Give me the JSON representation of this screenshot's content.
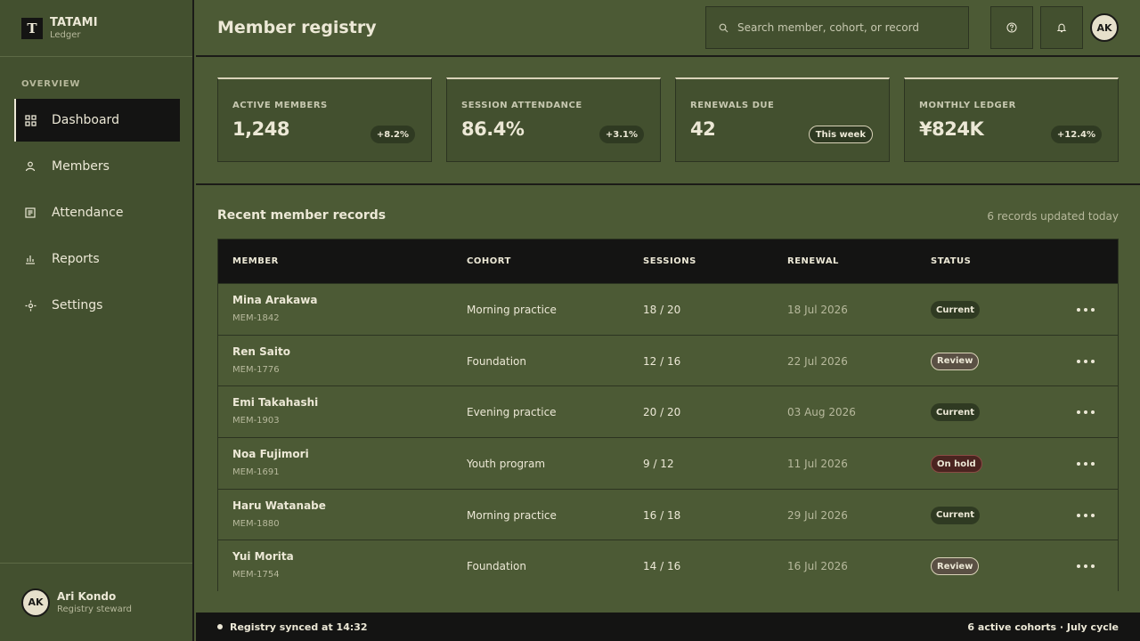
{
  "brand": {
    "mark": "T",
    "name": "TATAMI",
    "sub": "Ledger"
  },
  "nav": {
    "section": "OVERVIEW",
    "items": [
      {
        "label": "Dashboard",
        "icon": "grid-icon",
        "active": true
      },
      {
        "label": "Members",
        "icon": "person-icon"
      },
      {
        "label": "Attendance",
        "icon": "list-icon"
      },
      {
        "label": "Reports",
        "icon": "bar-chart-icon"
      },
      {
        "label": "Settings",
        "icon": "gear-icon"
      }
    ]
  },
  "user": {
    "initials": "AK",
    "name": "Ari Kondo",
    "role": "Registry steward"
  },
  "header": {
    "title": "Member registry",
    "search_placeholder": "Search member, cohort, or record",
    "avatar": "AK"
  },
  "kpis": [
    {
      "label": "ACTIVE MEMBERS",
      "value": "1,248",
      "badge": "+8.2%"
    },
    {
      "label": "SESSION ATTENDANCE",
      "value": "86.4%",
      "badge": "+3.1%"
    },
    {
      "label": "RENEWALS DUE",
      "value": "42",
      "badge": "This week"
    },
    {
      "label": "MONTHLY LEDGER",
      "value": "¥824K",
      "badge": "+12.4%"
    }
  ],
  "records": {
    "title": "Recent member records",
    "meta": "6 records updated today",
    "columns": [
      "MEMBER",
      "COHORT",
      "SESSIONS",
      "RENEWAL",
      "STATUS"
    ],
    "rows": [
      {
        "name": "Mina Arakawa",
        "id": "MEM-1842",
        "cohort": "Morning practice",
        "sessions": "18 / 20",
        "renewal": "18 Jul 2026",
        "status": "Current"
      },
      {
        "name": "Ren Saito",
        "id": "MEM-1776",
        "cohort": "Foundation",
        "sessions": "12 / 16",
        "renewal": "22 Jul 2026",
        "status": "Review"
      },
      {
        "name": "Emi Takahashi",
        "id": "MEM-1903",
        "cohort": "Evening practice",
        "sessions": "20 / 20",
        "renewal": "03 Aug 2026",
        "status": "Current"
      },
      {
        "name": "Noa Fujimori",
        "id": "MEM-1691",
        "cohort": "Youth program",
        "sessions": "9 / 12",
        "renewal": "11 Jul 2026",
        "status": "On hold"
      },
      {
        "name": "Haru Watanabe",
        "id": "MEM-1880",
        "cohort": "Morning practice",
        "sessions": "16 / 18",
        "renewal": "29 Jul 2026",
        "status": "Current"
      },
      {
        "name": "Yui Morita",
        "id": "MEM-1754",
        "cohort": "Foundation",
        "sessions": "14 / 16",
        "renewal": "16 Jul 2026",
        "status": "Review"
      }
    ]
  },
  "statusbar": {
    "sync": "Registry synced at 14:32",
    "right": "6 active cohorts · July cycle"
  }
}
